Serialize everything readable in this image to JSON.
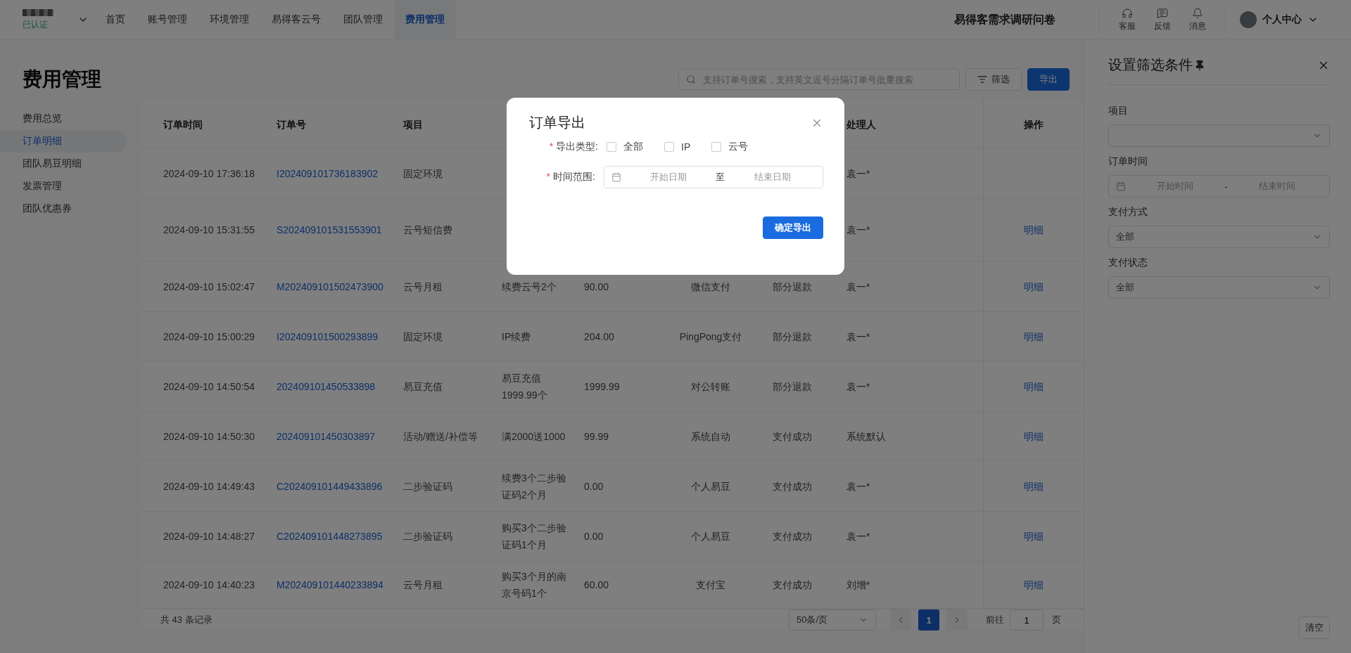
{
  "top_nav": {
    "verified_label": "已认证",
    "items": [
      {
        "label": "首页",
        "selected": false
      },
      {
        "label": "账号管理",
        "selected": false
      },
      {
        "label": "环境管理",
        "selected": false
      },
      {
        "label": "易得客云号",
        "selected": false
      },
      {
        "label": "团队管理",
        "selected": false
      },
      {
        "label": "费用管理",
        "selected": true
      }
    ],
    "survey_link": "易得客需求调研问卷",
    "icon_buttons": [
      {
        "kind": "headset",
        "label": "客服"
      },
      {
        "kind": "feedback",
        "label": "反馈"
      },
      {
        "kind": "bell",
        "label": "消息"
      }
    ],
    "user_menu": "个人中心"
  },
  "page_title": "费用管理",
  "sidebar": {
    "items": [
      {
        "label": "费用总览",
        "selected": false
      },
      {
        "label": "订单明细",
        "selected": true
      },
      {
        "label": "团队易豆明细",
        "selected": false
      },
      {
        "label": "发票管理",
        "selected": false
      },
      {
        "label": "团队优惠券",
        "selected": false
      }
    ]
  },
  "toolbar": {
    "search": {
      "placeholder": "支持订单号搜索，支持英文逗号分隔订单号批量搜索"
    },
    "filter_button": "筛选",
    "export_button": "导出"
  },
  "table": {
    "columns": [
      {
        "kind": "text",
        "label": "订单时间"
      },
      {
        "kind": "link",
        "label": "订单号"
      },
      {
        "kind": "text",
        "label": "项目"
      },
      {
        "kind": "text"
      },
      {
        "kind": "text"
      },
      {
        "kind": "centered"
      },
      {
        "kind": "text"
      },
      {
        "kind": "text",
        "label": "处理人"
      },
      {
        "kind": "action",
        "label": "操作"
      }
    ],
    "rows": [
      {
        "cells": [
          "2024-09-10 17:36:18",
          "I202409101736183902",
          "固定环境",
          null,
          null,
          null,
          null,
          "袁一*",
          null
        ]
      },
      {
        "cells": [
          "2024-09-10 15:31:55",
          "S202409101531553901",
          "云号短信费",
          null,
          null,
          null,
          null,
          "袁一*",
          "明细"
        ]
      },
      {
        "cells": [
          "2024-09-10 15:02:47",
          "M202409101502473900",
          "云号月租",
          "续费云号2个",
          "90.00",
          "微信支付",
          "部分退款",
          "袁一*",
          "明细"
        ]
      },
      {
        "cells": [
          "2024-09-10 15:00:29",
          "I202409101500293899",
          "固定环境",
          "IP续费",
          "204.00",
          "PingPong支付",
          "部分退款",
          "袁一*",
          "明细"
        ]
      },
      {
        "cells": [
          "2024-09-10 14:50:54",
          "202409101450533898",
          "易豆充值",
          "易豆充值1999.99个",
          "1999.99",
          "对公转账",
          "部分退款",
          "袁一*",
          "明细"
        ]
      },
      {
        "cells": [
          "2024-09-10 14:50:30",
          "202409101450303897",
          "活动/赠送/补偿等",
          "满2000送1000",
          "99.99",
          "系统自动",
          "支付成功",
          "系统默认",
          "明细"
        ]
      },
      {
        "cells": [
          "2024-09-10 14:49:43",
          "C202409101449433896",
          "二步验证码",
          "续费3个二步验证码2个月",
          "0.00",
          "个人易豆",
          "支付成功",
          "袁一*",
          "明细"
        ]
      },
      {
        "cells": [
          "2024-09-10 14:48:27",
          "C202409101448273895",
          "二步验证码",
          "购买3个二步验证码1个月",
          "0.00",
          "个人易豆",
          "支付成功",
          "袁一*",
          "明细"
        ]
      },
      {
        "cells": [
          "2024-09-10 14:40:23",
          "M202409101440233894",
          "云号月租",
          "购买3个月的南京号码1个",
          "60.00",
          "支付宝",
          "支付成功",
          "刘增*",
          "明细"
        ]
      }
    ]
  },
  "pagination": {
    "total": "共 43 条记录",
    "page_size": "50条/页",
    "pages": [
      {
        "label": "1",
        "selected": true
      }
    ],
    "goto_label": "前往",
    "goto_value": "1",
    "page_suffix": "页"
  },
  "filter_panel": {
    "title": "设置筛选条件",
    "fields": [
      {
        "kind": "select",
        "label": "项目"
      },
      {
        "kind": "date_range",
        "label": "订单时间",
        "start_placeholder": "开始时间",
        "separator": "-",
        "end_placeholder": "结束时间"
      },
      {
        "kind": "select",
        "label": "支付方式",
        "value": "全部"
      },
      {
        "kind": "select",
        "label": "支付状态",
        "value": "全部"
      }
    ],
    "clear_button": "清空"
  },
  "export_dialog": {
    "title": "订单导出",
    "fields": [
      {
        "kind": "checkboxes",
        "required_mark": "*",
        "label": "导出类型:",
        "options": [
          {
            "label": "全部",
            "checked": false
          },
          {
            "label": "IP",
            "checked": false
          },
          {
            "label": "云号",
            "checked": false
          }
        ]
      },
      {
        "kind": "date_range",
        "required_mark": "*",
        "label": "时间范围:",
        "start_placeholder": "开始日期",
        "separator": "至",
        "end_placeholder": "结束日期"
      }
    ],
    "confirm_button": "确定导出"
  }
}
